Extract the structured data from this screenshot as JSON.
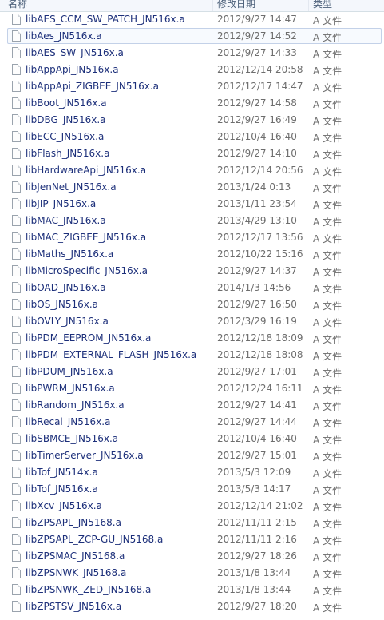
{
  "columns": {
    "name": "名称",
    "date": "修改日期",
    "type": "类型"
  },
  "selected_index": 1,
  "files": [
    {
      "name": "libAES_CCM_SW_PATCH_JN516x.a",
      "date": "2012/9/27 14:47",
      "type": "A 文件"
    },
    {
      "name": "libAes_JN516x.a",
      "date": "2012/9/27 14:52",
      "type": "A 文件"
    },
    {
      "name": "libAES_SW_JN516x.a",
      "date": "2012/9/27 14:33",
      "type": "A 文件"
    },
    {
      "name": "libAppApi_JN516x.a",
      "date": "2012/12/14 20:58",
      "type": "A 文件"
    },
    {
      "name": "libAppApi_ZIGBEE_JN516x.a",
      "date": "2012/12/17 14:47",
      "type": "A 文件"
    },
    {
      "name": "libBoot_JN516x.a",
      "date": "2012/9/27 14:58",
      "type": "A 文件"
    },
    {
      "name": "libDBG_JN516x.a",
      "date": "2012/9/27 16:49",
      "type": "A 文件"
    },
    {
      "name": "libECC_JN516x.a",
      "date": "2012/10/4 16:40",
      "type": "A 文件"
    },
    {
      "name": "libFlash_JN516x.a",
      "date": "2012/9/27 14:10",
      "type": "A 文件"
    },
    {
      "name": "libHardwareApi_JN516x.a",
      "date": "2012/12/14 20:56",
      "type": "A 文件"
    },
    {
      "name": "libJenNet_JN516x.a",
      "date": "2013/1/24 0:13",
      "type": "A 文件"
    },
    {
      "name": "libJIP_JN516x.a",
      "date": "2013/1/11 23:54",
      "type": "A 文件"
    },
    {
      "name": "libMAC_JN516x.a",
      "date": "2013/4/29 13:10",
      "type": "A 文件"
    },
    {
      "name": "libMAC_ZIGBEE_JN516x.a",
      "date": "2012/12/17 13:56",
      "type": "A 文件"
    },
    {
      "name": "libMaths_JN516x.a",
      "date": "2012/10/22 15:16",
      "type": "A 文件"
    },
    {
      "name": "libMicroSpecific_JN516x.a",
      "date": "2012/9/27 14:37",
      "type": "A 文件"
    },
    {
      "name": "libOAD_JN516x.a",
      "date": "2014/1/3 14:56",
      "type": "A 文件"
    },
    {
      "name": "libOS_JN516x.a",
      "date": "2012/9/27 16:50",
      "type": "A 文件"
    },
    {
      "name": "libOVLY_JN516x.a",
      "date": "2012/3/29 16:19",
      "type": "A 文件"
    },
    {
      "name": "libPDM_EEPROM_JN516x.a",
      "date": "2012/12/18 18:09",
      "type": "A 文件"
    },
    {
      "name": "libPDM_EXTERNAL_FLASH_JN516x.a",
      "date": "2012/12/18 18:08",
      "type": "A 文件"
    },
    {
      "name": "libPDUM_JN516x.a",
      "date": "2012/9/27 17:01",
      "type": "A 文件"
    },
    {
      "name": "libPWRM_JN516x.a",
      "date": "2012/12/24 16:11",
      "type": "A 文件"
    },
    {
      "name": "libRandom_JN516x.a",
      "date": "2012/9/27 14:41",
      "type": "A 文件"
    },
    {
      "name": "libRecal_JN516x.a",
      "date": "2012/9/27 14:44",
      "type": "A 文件"
    },
    {
      "name": "libSBMCE_JN516x.a",
      "date": "2012/10/4 16:40",
      "type": "A 文件"
    },
    {
      "name": "libTimerServer_JN516x.a",
      "date": "2012/9/27 15:01",
      "type": "A 文件"
    },
    {
      "name": "libTof_JN514x.a",
      "date": "2013/5/3 12:09",
      "type": "A 文件"
    },
    {
      "name": "libTof_JN516x.a",
      "date": "2013/5/3 14:17",
      "type": "A 文件"
    },
    {
      "name": "libXcv_JN516x.a",
      "date": "2012/12/14 21:02",
      "type": "A 文件"
    },
    {
      "name": "libZPSAPL_JN5168.a",
      "date": "2012/11/11 2:15",
      "type": "A 文件"
    },
    {
      "name": "libZPSAPL_ZCP-GU_JN5168.a",
      "date": "2012/11/11 2:16",
      "type": "A 文件"
    },
    {
      "name": "libZPSMAC_JN5168.a",
      "date": "2012/9/27 18:26",
      "type": "A 文件"
    },
    {
      "name": "libZPSNWK_JN5168.a",
      "date": "2013/1/8 13:44",
      "type": "A 文件"
    },
    {
      "name": "libZPSNWK_ZED_JN5168.a",
      "date": "2013/1/8 13:44",
      "type": "A 文件"
    },
    {
      "name": "libZPSTSV_JN516x.a",
      "date": "2012/9/27 18:20",
      "type": "A 文件"
    }
  ]
}
